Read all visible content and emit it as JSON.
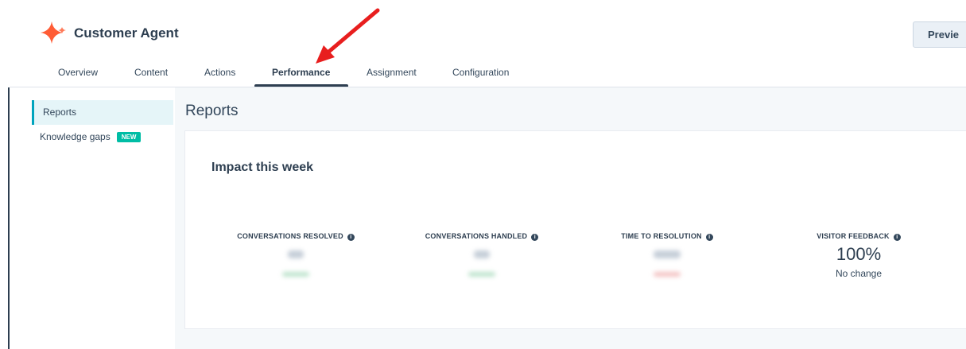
{
  "app": {
    "title": "Customer Agent",
    "preview_label": "Previe"
  },
  "tabs": [
    {
      "label": "Overview"
    },
    {
      "label": "Content"
    },
    {
      "label": "Actions"
    },
    {
      "label": "Performance",
      "active": true
    },
    {
      "label": "Assignment"
    },
    {
      "label": "Configuration"
    }
  ],
  "sidebar": {
    "items": [
      {
        "label": "Reports",
        "active": true
      },
      {
        "label": "Knowledge gaps",
        "badge": "NEW"
      }
    ]
  },
  "main": {
    "title": "Reports",
    "card_title": "Impact this week",
    "metrics": [
      {
        "label": "CONVERSATIONS RESOLVED",
        "trend": "positive"
      },
      {
        "label": "CONVERSATIONS HANDLED",
        "trend": "positive"
      },
      {
        "label": "TIME TO RESOLUTION",
        "trend": "negative"
      },
      {
        "label": "VISITOR FEEDBACK",
        "value": "100%",
        "change": "No change"
      }
    ]
  },
  "colors": {
    "accent": "#00a4bd",
    "badge": "#00bda5",
    "arrow": "#e81e1e",
    "logo": "#ff5c35"
  }
}
